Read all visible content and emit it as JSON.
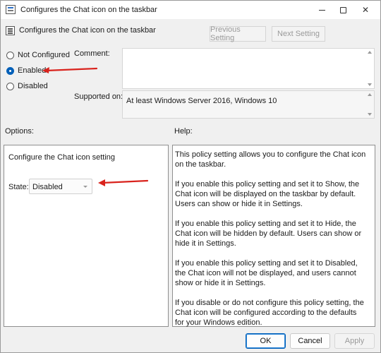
{
  "titlebar": {
    "title": "Configures the Chat icon on the taskbar",
    "min_icon": "minimize-icon",
    "max_icon": "maximize-icon",
    "close_icon": "close-icon",
    "close_glyph": "✕"
  },
  "header": {
    "title": "Configures the Chat icon on the taskbar",
    "prev_label": "Previous Setting",
    "next_label": "Next Setting"
  },
  "state_options": {
    "not_configured": "Not Configured",
    "enabled": "Enabled",
    "disabled": "Disabled",
    "selected": "enabled"
  },
  "comment": {
    "label": "Comment:",
    "value": ""
  },
  "supported": {
    "label": "Supported on:",
    "value": "At least Windows Server 2016, Windows 10"
  },
  "options": {
    "label": "Options:",
    "setting_title": "Configure the Chat icon setting",
    "state_label": "State:",
    "state_value": "Disabled"
  },
  "help": {
    "label": "Help:",
    "paragraphs": [
      "This policy setting allows you to configure the Chat icon on the taskbar.",
      "If you enable this policy setting and set it to Show, the Chat icon will be displayed on the taskbar by default. Users can show or hide it in Settings.",
      "If you enable this policy setting and set it to Hide, the Chat icon will be hidden by default. Users can show or hide it in Settings.",
      "If you enable this policy setting and set it to Disabled, the Chat icon will not be displayed, and users cannot show or hide it in Settings.",
      "If you disable or do not configure this policy setting, the Chat icon will be configured according to the defaults for your Windows edition."
    ]
  },
  "buttons": {
    "ok": "OK",
    "cancel": "Cancel",
    "apply": "Apply"
  },
  "colors": {
    "accent": "#005fb8",
    "annotation_arrow": "#d9231d"
  }
}
